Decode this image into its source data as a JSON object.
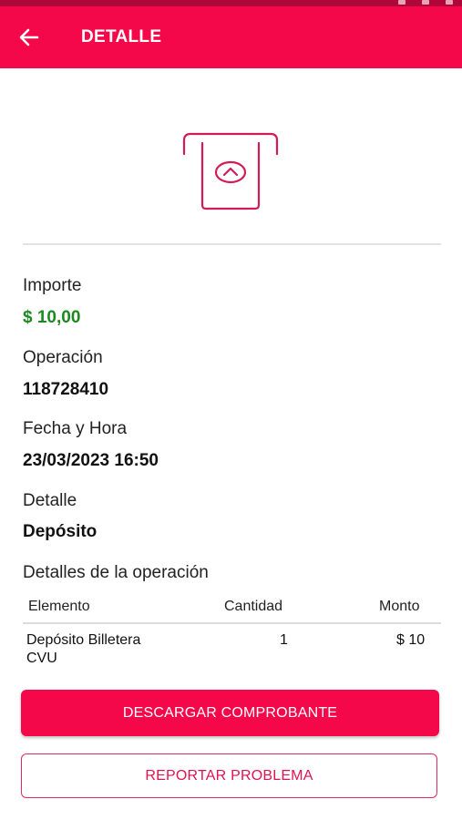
{
  "header": {
    "title": "DETALLE",
    "back_icon": "arrow-left-icon",
    "color": "#f4084a"
  },
  "hero": {
    "icon": "atm-deposit-icon",
    "color": "#d31c56"
  },
  "fields": [
    {
      "label": "Importe",
      "value": "$ 10,00"
    },
    {
      "label": "Operación",
      "value": "118728410"
    },
    {
      "label": "Fecha y Hora",
      "value": "23/03/2023 16:50"
    },
    {
      "label": "Detalle",
      "value": "Depósito"
    }
  ],
  "money_color": "#1b8a1e",
  "operation_details": {
    "title": "Detalles de la operación",
    "columns": [
      "Elemento",
      "Cantidad",
      "Monto"
    ],
    "rows": [
      {
        "element_line1": "Depósito Billetera",
        "element_line2": "CVU",
        "quantity": "1",
        "amount": "$ 10"
      }
    ]
  },
  "actions": {
    "download_label": "DESCARGAR COMPROBANTE",
    "report_label": "REPORTAR PROBLEMA"
  }
}
